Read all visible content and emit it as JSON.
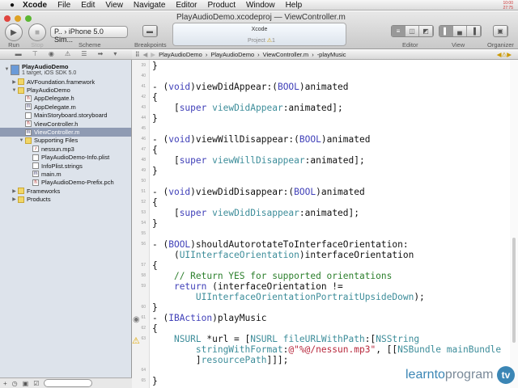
{
  "menubar": {
    "app": "Xcode",
    "items": [
      "File",
      "Edit",
      "View",
      "Navigate",
      "Editor",
      "Product",
      "Window",
      "Help"
    ],
    "clock": [
      "10:00",
      "27:75"
    ]
  },
  "window": {
    "project": "PlayAudioDemo.xcodeproj",
    "sep": "—",
    "file": "ViewController.m"
  },
  "toolbar": {
    "run": "Run",
    "stop": "Stop",
    "scheme_target": "P..",
    "scheme_dest": "iPhone 5.0 Sim...",
    "scheme": "Scheme",
    "breakpoints": "Breakpoints",
    "activity_title": "Xcode",
    "activity_project": "Project",
    "warnings": "1",
    "editor": "Editor",
    "view": "View",
    "organizer": "Organizer"
  },
  "jumpbar": [
    "PlayAudioDemo",
    "PlayAudioDemo",
    "ViewController.m",
    "-playMusic"
  ],
  "navigator": [
    {
      "label": "PlayAudioDemo",
      "sub": "1 target, iOS SDK 5.0",
      "indent": 0,
      "tri": "▼",
      "icon": "project"
    },
    {
      "label": "AVFoundation.framework",
      "indent": 1,
      "tri": "▶",
      "icon": "framework"
    },
    {
      "label": "PlayAudioDemo",
      "indent": 1,
      "tri": "▼",
      "icon": "folder"
    },
    {
      "label": "AppDelegate.h",
      "indent": 2,
      "icon": "h"
    },
    {
      "label": "AppDelegate.m",
      "indent": 2,
      "icon": "m"
    },
    {
      "label": "MainStoryboard.storyboard",
      "indent": 2,
      "icon": "storyboard"
    },
    {
      "label": "ViewController.h",
      "indent": 2,
      "icon": "h"
    },
    {
      "label": "ViewController.m",
      "indent": 2,
      "icon": "m",
      "selected": true
    },
    {
      "label": "Supporting Files",
      "indent": 2,
      "tri": "▼",
      "icon": "folder"
    },
    {
      "label": "nessun.mp3",
      "indent": 3,
      "icon": "audio"
    },
    {
      "label": "PlayAudioDemo-Info.plist",
      "indent": 3,
      "icon": "file"
    },
    {
      "label": "InfoPlist.strings",
      "indent": 3,
      "icon": "file"
    },
    {
      "label": "main.m",
      "indent": 3,
      "icon": "m"
    },
    {
      "label": "PlayAudioDemo-Prefix.pch",
      "indent": 3,
      "icon": "h"
    },
    {
      "label": "Frameworks",
      "indent": 1,
      "tri": "▶",
      "icon": "folder"
    },
    {
      "label": "Products",
      "indent": 1,
      "tri": "▶",
      "icon": "folder"
    }
  ],
  "code": [
    {
      "n": "39",
      "segs": [
        [
          "}",
          ""
        ]
      ]
    },
    {
      "n": "40",
      "segs": []
    },
    {
      "n": "41",
      "segs": [
        [
          "- (",
          ""
        ],
        [
          "void",
          "k"
        ],
        [
          ")viewDidAppear:(",
          ""
        ],
        [
          "BOOL",
          "k"
        ],
        [
          ")animated",
          ""
        ]
      ]
    },
    {
      "n": "42",
      "segs": [
        [
          "{",
          ""
        ]
      ]
    },
    {
      "n": "43",
      "segs": [
        [
          "    [",
          ""
        ],
        [
          "super",
          "k"
        ],
        [
          " ",
          ""
        ],
        [
          "viewDidAppear",
          "m"
        ],
        [
          ":animated];",
          ""
        ]
      ]
    },
    {
      "n": "44",
      "segs": [
        [
          "}",
          ""
        ]
      ]
    },
    {
      "n": "45",
      "segs": []
    },
    {
      "n": "46",
      "segs": [
        [
          "- (",
          ""
        ],
        [
          "void",
          "k"
        ],
        [
          ")viewWillDisappear:(",
          ""
        ],
        [
          "BOOL",
          "k"
        ],
        [
          ")animated",
          ""
        ]
      ]
    },
    {
      "n": "47",
      "segs": [
        [
          "{",
          ""
        ]
      ]
    },
    {
      "n": "48",
      "segs": [
        [
          "    [",
          ""
        ],
        [
          "super",
          "k"
        ],
        [
          " ",
          ""
        ],
        [
          "viewWillDisappear",
          "m"
        ],
        [
          ":animated];",
          ""
        ]
      ]
    },
    {
      "n": "49",
      "segs": [
        [
          "}",
          ""
        ]
      ]
    },
    {
      "n": "50",
      "segs": []
    },
    {
      "n": "51",
      "segs": [
        [
          "- (",
          ""
        ],
        [
          "void",
          "k"
        ],
        [
          ")viewDidDisappear:(",
          ""
        ],
        [
          "BOOL",
          "k"
        ],
        [
          ")animated",
          ""
        ]
      ]
    },
    {
      "n": "52",
      "segs": [
        [
          "{",
          ""
        ]
      ]
    },
    {
      "n": "53",
      "segs": [
        [
          "    [",
          ""
        ],
        [
          "super",
          "k"
        ],
        [
          " ",
          ""
        ],
        [
          "viewDidDisappear",
          "m"
        ],
        [
          ":animated];",
          ""
        ]
      ]
    },
    {
      "n": "54",
      "segs": [
        [
          "}",
          ""
        ]
      ]
    },
    {
      "n": "55",
      "segs": []
    },
    {
      "n": "56",
      "segs": [
        [
          "- (",
          ""
        ],
        [
          "BOOL",
          "k"
        ],
        [
          ")shouldAutorotateToInterfaceOrientation:",
          ""
        ]
      ]
    },
    {
      "n": "",
      "segs": [
        [
          "    (",
          ""
        ],
        [
          "UIInterfaceOrientation",
          "m"
        ],
        [
          ")interfaceOrientation",
          ""
        ]
      ]
    },
    {
      "n": "57",
      "segs": [
        [
          "{",
          ""
        ]
      ]
    },
    {
      "n": "58",
      "segs": [
        [
          "    ",
          ""
        ],
        [
          "// Return YES for supported orientations",
          "c"
        ]
      ]
    },
    {
      "n": "59",
      "segs": [
        [
          "    ",
          ""
        ],
        [
          "return",
          "k"
        ],
        [
          " (interfaceOrientation !=",
          ""
        ]
      ]
    },
    {
      "n": "",
      "segs": [
        [
          "        ",
          ""
        ],
        [
          "UIInterfaceOrientationPortraitUpsideDown",
          "m"
        ],
        [
          ");",
          ""
        ]
      ]
    },
    {
      "n": "60",
      "segs": [
        [
          "}",
          ""
        ]
      ]
    },
    {
      "n": "61",
      "segs": [
        [
          "- (",
          ""
        ],
        [
          "IBAction",
          "k"
        ],
        [
          ")playMusic",
          ""
        ]
      ]
    },
    {
      "n": "62",
      "segs": [
        [
          "{",
          ""
        ]
      ]
    },
    {
      "n": "63",
      "segs": [
        [
          "    ",
          ""
        ],
        [
          "NSURL",
          "m"
        ],
        [
          " *url = [",
          ""
        ],
        [
          "NSURL",
          "m"
        ],
        [
          " ",
          ""
        ],
        [
          "fileURLWithPath",
          "m"
        ],
        [
          ":[",
          ""
        ],
        [
          "NSString",
          "m"
        ]
      ]
    },
    {
      "n": "",
      "segs": [
        [
          "        ",
          ""
        ],
        [
          "stringWithFormat",
          "m"
        ],
        [
          ":",
          ""
        ],
        [
          "@\"%@/nessun.mp3\"",
          "s"
        ],
        [
          ", [[",
          ""
        ],
        [
          "NSBundle",
          "m"
        ],
        [
          " ",
          ""
        ],
        [
          "mainBundle",
          "m"
        ]
      ]
    },
    {
      "n": "",
      "segs": [
        [
          "        ]",
          ""
        ],
        [
          "resourcePath",
          "m"
        ],
        [
          "]]];",
          ""
        ]
      ]
    },
    {
      "n": "64",
      "segs": []
    },
    {
      "n": "65",
      "segs": [
        [
          "}",
          ""
        ]
      ]
    }
  ],
  "watermark": {
    "a": "learnto",
    "b": "program",
    "c": "tv"
  }
}
